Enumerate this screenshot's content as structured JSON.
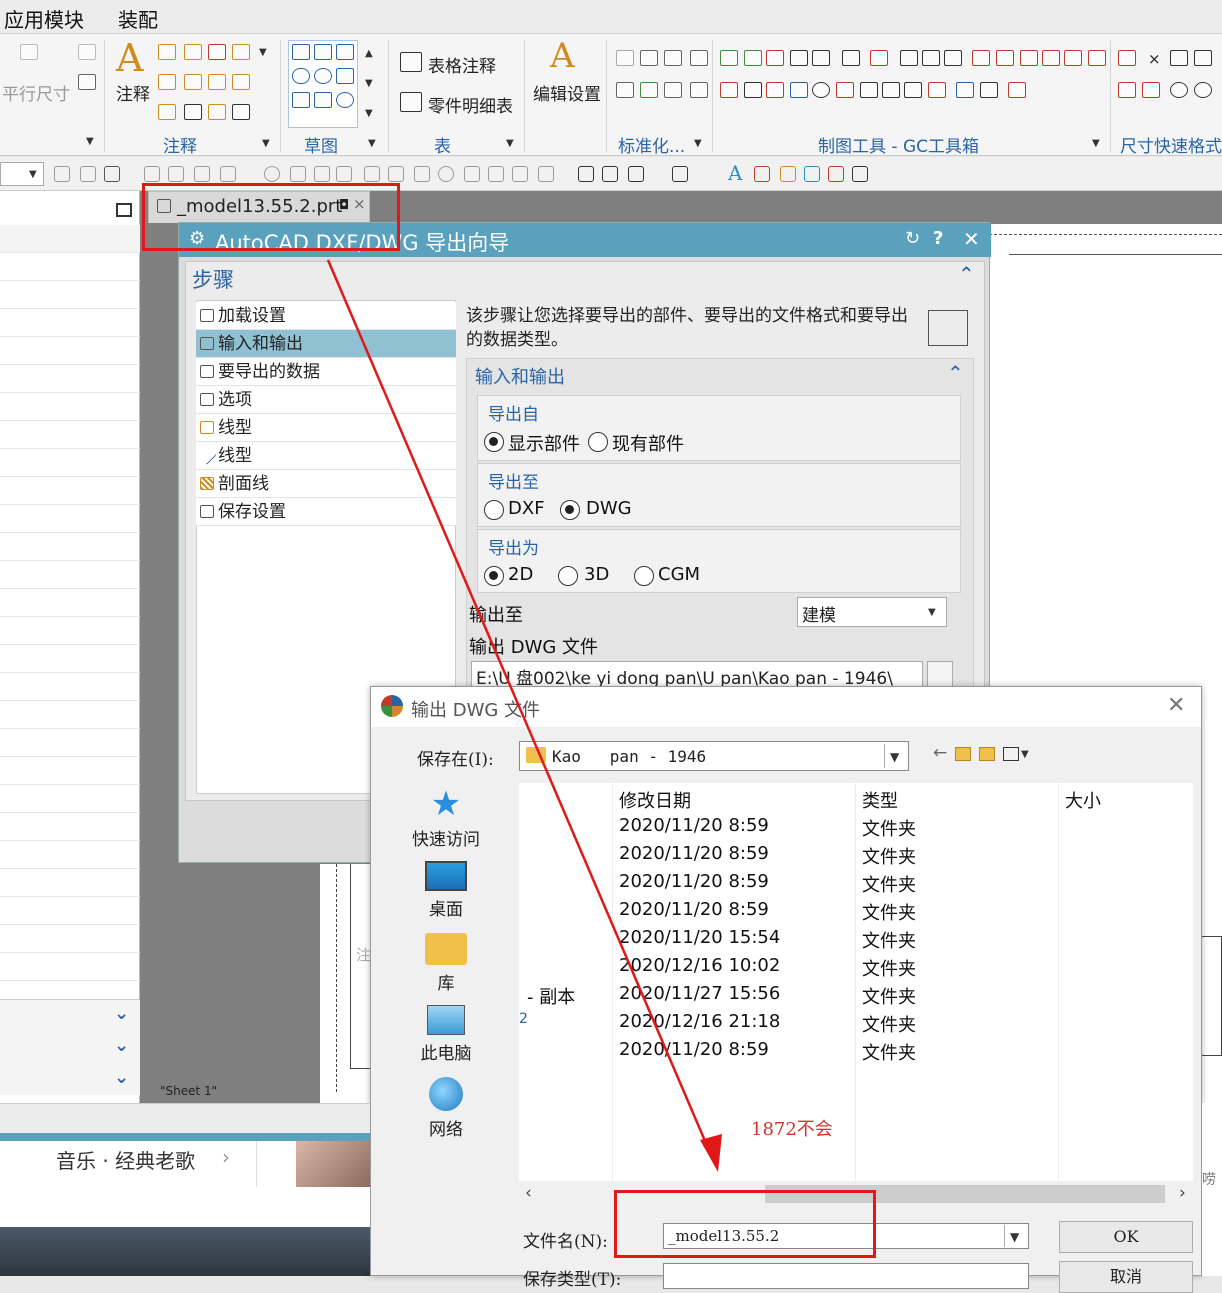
{
  "menubar": {
    "items": [
      "应用模块",
      "装配"
    ]
  },
  "ribbon": {
    "left_cut_label": "平行尺寸",
    "annotation_big": "注释",
    "table_notes": "表格注释",
    "parts_list": "零件明细表",
    "edit_settings": "编辑设置",
    "groups": [
      "注释",
      "草图",
      "表",
      "标准化...",
      "制图工具 - GC工具箱",
      "尺寸快速格式"
    ]
  },
  "tab": {
    "label": "_model13.55.2.prt"
  },
  "graphics": {
    "sheet_label": "\"Sheet 1\"",
    "stray_char": "注"
  },
  "dialog": {
    "title": "AutoCAD DXF/DWG 导出向导",
    "steps_header": "步骤",
    "steps": [
      "加载设置",
      "输入和输出",
      "要导出的数据",
      "选项",
      "线型",
      "线型",
      "剖面线",
      "保存设置"
    ],
    "description": "该步骤让您选择要导出的部件、要导出的文件格式和要导出的数据类型。",
    "section_title": "输入和输出",
    "export_from": {
      "title": "导出自",
      "options": [
        "显示部件",
        "现有部件"
      ],
      "selected": 0
    },
    "export_to": {
      "title": "导出至",
      "options": [
        "DXF",
        "DWG"
      ],
      "selected": 1
    },
    "export_as": {
      "title": "导出为",
      "options": [
        "2D",
        "3D",
        "CGM"
      ],
      "selected": 0
    },
    "output_to_label": "输出至",
    "output_to_value": "建模",
    "output_file_label": "输出 DWG 文件",
    "output_file_path": "E:\\U 盘002\\ke yi dong pan\\U pan\\Kao   pan - 1946\\"
  },
  "file_dialog": {
    "title": "输出 DWG 文件",
    "save_in_label": "保存在(I):",
    "save_in_value": "Kao   pan - 1946",
    "nav": [
      "快速访问",
      "桌面",
      "库",
      "此电脑",
      "网络"
    ],
    "columns": [
      "修改日期",
      "类型",
      "大小"
    ],
    "rows": [
      {
        "name": "",
        "date": "2020/11/20 8:59",
        "type": "文件夹"
      },
      {
        "name": "",
        "date": "2020/11/20 8:59",
        "type": "文件夹"
      },
      {
        "name": "",
        "date": "2020/11/20 8:59",
        "type": "文件夹"
      },
      {
        "name": "",
        "date": "2020/11/20 8:59",
        "type": "文件夹"
      },
      {
        "name": "",
        "date": "2020/11/20 15:54",
        "type": "文件夹"
      },
      {
        "name": "",
        "date": "2020/12/16 10:02",
        "type": "文件夹"
      },
      {
        "name": "- 副本",
        "date": "2020/11/27 15:56",
        "type": "文件夹"
      },
      {
        "name": "2",
        "date": "2020/12/16 21:18",
        "type": "文件夹"
      },
      {
        "name": "",
        "date": "2020/11/20 8:59",
        "type": "文件夹"
      }
    ],
    "annotation": "1872不会",
    "filename_label": "文件名(N):",
    "filename_value": "_model13.55.2",
    "filetype_label": "保存类型(T):",
    "ok_label": "OK",
    "cancel_label": "取消"
  },
  "taskbar": {
    "music_label": "音乐 · 经典老歌",
    "right_cut": "唠"
  }
}
